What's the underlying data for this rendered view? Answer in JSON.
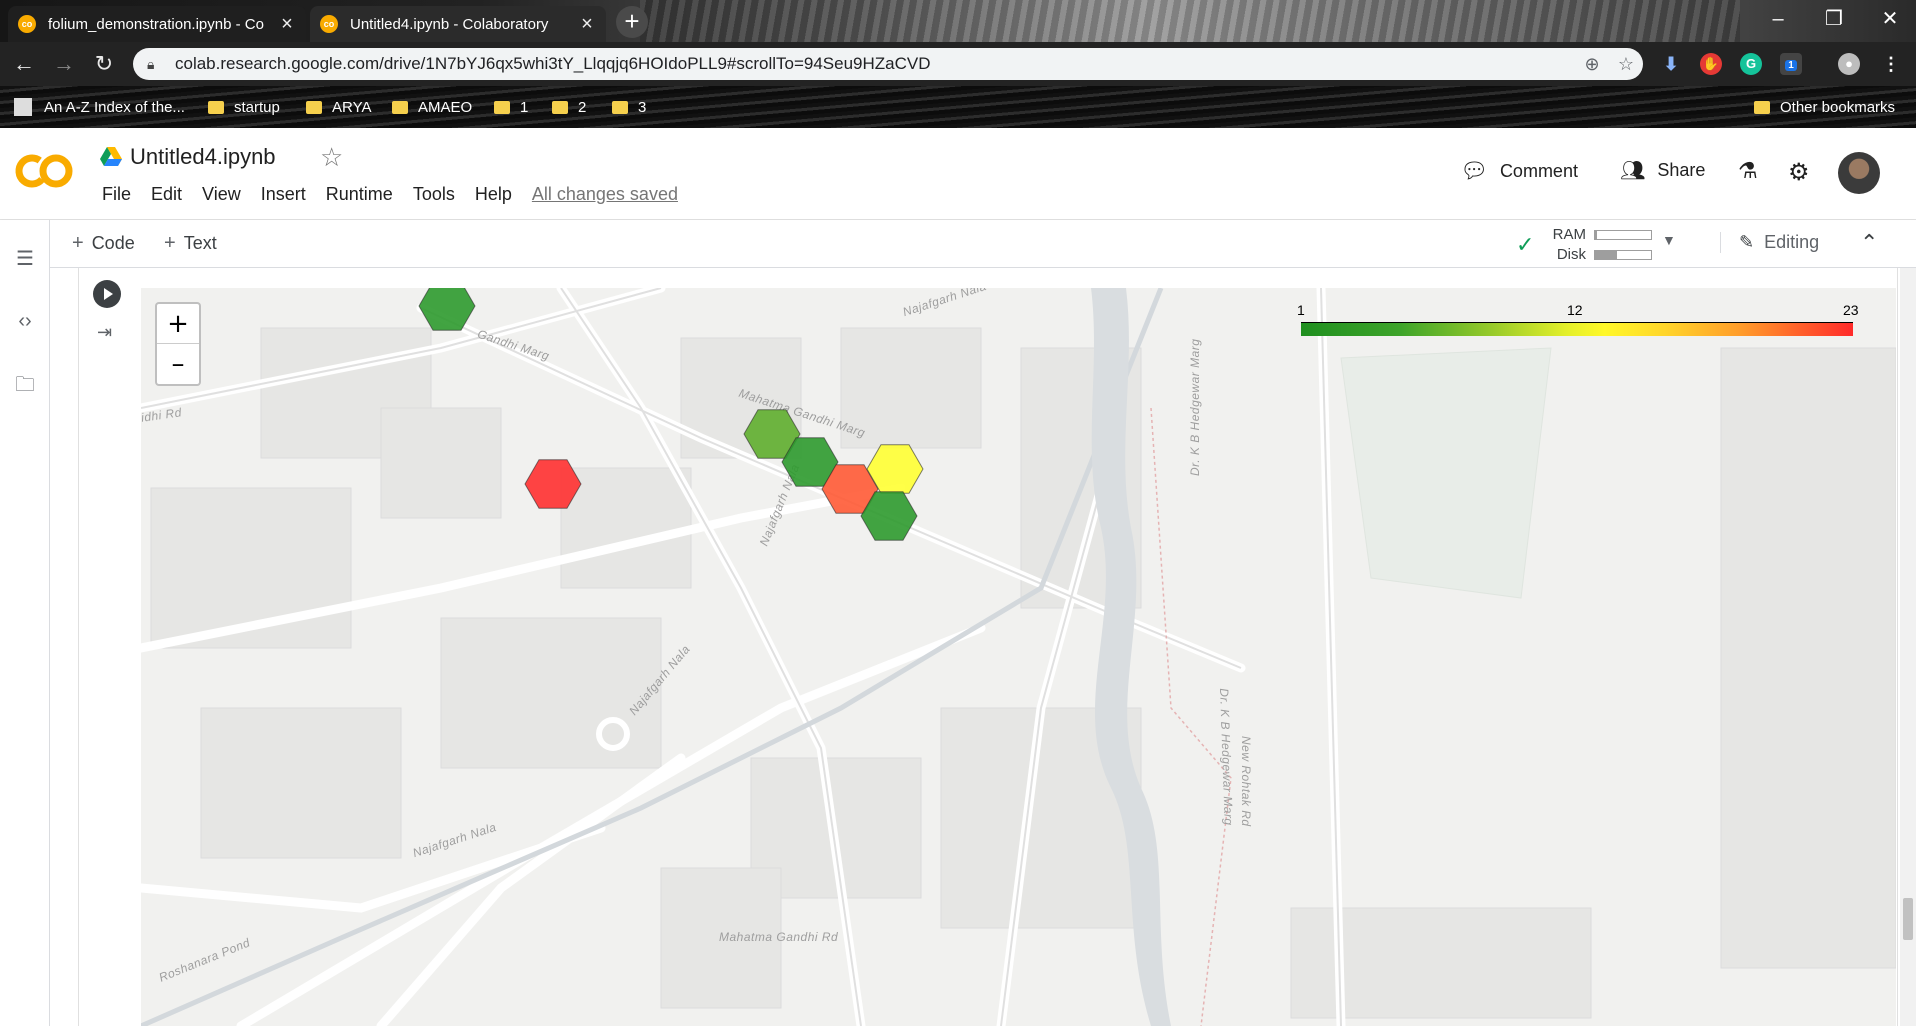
{
  "browser": {
    "tabs": [
      {
        "title": "folium_demonstration.ipynb - Co",
        "active": false
      },
      {
        "title": "Untitled4.ipynb - Colaboratory",
        "active": true
      }
    ],
    "url": "colab.research.google.com/drive/1N7bYJ6qx5whi3tY_Llqqjq6HOIdoPLL9#scrollTo=94Seu9HZaCVD",
    "bookmarks": [
      "An A-Z Index of the...",
      "startup",
      "ARYA",
      "AMAEO",
      "1",
      "2",
      "3"
    ],
    "other_bookmarks": "Other bookmarks",
    "extension_badge": "1"
  },
  "colab": {
    "logo_text": "CO",
    "notebook_title": "Untitled4.ipynb",
    "menus": [
      "File",
      "Edit",
      "View",
      "Insert",
      "Runtime",
      "Tools",
      "Help"
    ],
    "save_status": "All changes saved",
    "comment_label": "Comment",
    "share_label": "Share",
    "toolbar": {
      "code_label": "Code",
      "text_label": "Text",
      "ram_label": "RAM",
      "disk_label": "Disk",
      "ram_fraction": 0.03,
      "disk_fraction": 0.4,
      "editing_label": "Editing"
    }
  },
  "map": {
    "zoom_in": "+",
    "zoom_out": "–",
    "legend": {
      "min": "1",
      "mid": "12",
      "max": "23"
    },
    "labels": [
      "Najafgarh Nala",
      "Gandhi Marg",
      "Mahatma Gandhi Marg",
      "idhi Rd",
      "Najafgarh Nala",
      "Najafgarh Nala",
      "Najafgarh Nala",
      "Roshanara Pond",
      "Mahatma Gandhi Rd",
      "Dr. K B Hedgewar Marg",
      "Dr. K B Hedgewar Marg",
      "New Rohtak Rd"
    ],
    "hexagon_colors": [
      "#2e9a2e",
      "#ff3030",
      "#5fae2d",
      "#2e9a2e",
      "#ff5a35",
      "#ffff33",
      "#2e9a2e"
    ]
  }
}
